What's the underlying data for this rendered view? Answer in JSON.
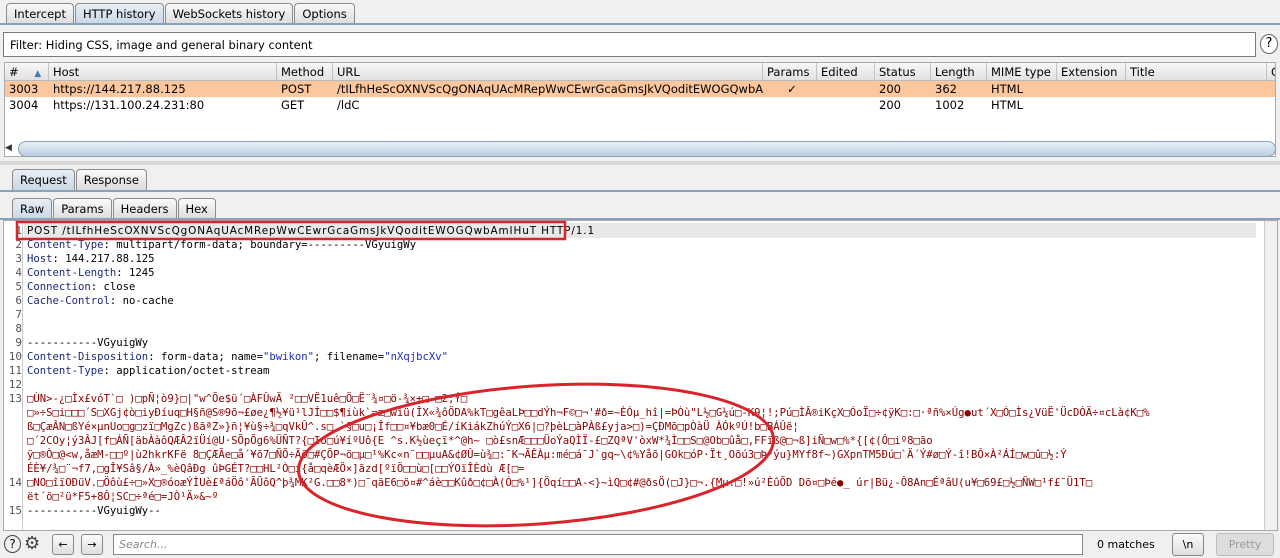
{
  "top_tabs": [
    "Intercept",
    "HTTP history",
    "WebSockets history",
    "Options"
  ],
  "filter": "Filter: Hiding CSS, image and general binary content",
  "help_icon": "?",
  "table": {
    "columns": [
      "#",
      "Host",
      "Method",
      "URL",
      "Params",
      "Edited",
      "Status",
      "Length",
      "MIME type",
      "Extension",
      "Title",
      "C"
    ],
    "sort_icon": "▲",
    "rows": [
      {
        "id": "3003",
        "host": "https://144.217.88.125",
        "method": "POST",
        "url": "/tILfhHeScOXNVScQgONAqUAcMRepWwCEwrGcaGmsJkVQoditEWOGQwbA...",
        "params": "✓",
        "edited": "",
        "status": "200",
        "length": "362",
        "mime": "HTML",
        "ext": "",
        "title": "",
        "selected": true
      },
      {
        "id": "3004",
        "host": "https://131.100.24.231:80",
        "method": "GET",
        "url": "/ldC",
        "params": "",
        "edited": "",
        "status": "200",
        "length": "1002",
        "mime": "HTML",
        "ext": "",
        "title": "",
        "selected": false
      }
    ]
  },
  "msg_tabs": [
    "Request",
    "Response"
  ],
  "view_tabs": [
    "Raw",
    "Params",
    "Headers",
    "Hex"
  ],
  "editor": {
    "line_numbers": [
      "1",
      "2",
      "3",
      "4",
      "5",
      "6",
      "7",
      "8",
      "9",
      "10",
      "11",
      "12",
      "13",
      "14",
      "15"
    ],
    "line1": "POST /tILfhHeScOXNVScQgONAqUAcMRepWwCEwrGcaGmsJkVQoditEWOGQwbAmIHuT HTTP/1.1",
    "headers": [
      {
        "name": "Content-Type",
        "value": ": multipart/form-data; boundary=---------VGyuigWy"
      },
      {
        "name": "Host",
        "value": ": 144.217.88.125"
      },
      {
        "name": "Content-Length",
        "value": ": 1245"
      },
      {
        "name": "Connection",
        "value": ": close"
      },
      {
        "name": "Cache-Control",
        "value": ": no-cache"
      }
    ],
    "boundary": "-----------VGyuigWy",
    "disposition": {
      "name": "Content-Disposition",
      "pre": ": form-data; name=",
      "field": "\"bwikon\"",
      "mid": "; filename=",
      "file": "\"nXqjbcXv\""
    },
    "part_type": {
      "name": "Content-Type",
      "value": ": application/octet-stream"
    },
    "binary_13": [
      "□ÙN>-¿□Ìx£vóT`□ )□pÑ¦ò9}□|\"w^Õe$ü´□ÀFÛwÃ ²□□VË1uê□Ö□Ë¨¾¤□ö-¾×+□ □2;Ý□",
      "□»÷S□i□□□´S□XGj¢ò□iyÐíuq□H§ñ@S®9õ¬£øe¿¶½¥ü¹lJÍ□□$¶iùk`=æ□wiü(ÎX«¾ôÖDA%kT□gêaLÞ□□dÝh¬F©□¬'#ð=~ÈÓµ_hî|=ÞÒù\"L½□G¼ú□-K9¦!;Pú□ÌÂ®iKçX□ÓoÏ□÷¢ÿK□:□·ªñ%×Úg●ut´X□Ó□Ìs¿VüË'ÜcDÓÄ÷¤cLà¢K□%",
      "ß□ÇæÂN□ßYé×µnUo□g□zï□MgZc)ßãªZ»}ñ¦¥ù§÷¾□qVkÛ^.s□ `§□u□¡Îf□□¤¥bæ0□É/íKiákZhúÝ□X6|□?þèL□àPÀß£yja>□)=ÇÐMõ□pÒàÜ ÀÓkºÚ!b□BÁÛë¦",
      "□´2COy¦ý3ÂJ[f□ÁÑ[äbÀàôQÆÂ2ïÜí@U·SÕpÕg6%ÜÑT?{□Io□ú¥íºUô{E ^s.K½ùeçï*^@h~ □ò£snÆ□□□ÜoÝaQÌÏ-£□ZQªV'òxW*¾Ì□□S□@Ob□ûå□,FFïß@□¬ß]iÑ□w□%*{[¢(Ô□iº8□ão",
      "ÿ□®Ò□@<w,åæM-□□º|ù2hkrKFë 8□ÇÆÃe□å´¥õ7□ÑÕ÷Ãõ□#ÇÕP¬ö□µ□¹%Kc«n¨□□µuA&¢ØÛ=ù¾□:¯K¬ÃÊÀµ:mé□á¯J`gq~\\¢%Yåõ|GOk□óP·Ït¸Oõú3□Þ³ýu}MYf8f~)GXpnTM5Ðú□`Ä´Ý#ø□Ý-î!BÔ×À²ÁÍ□w□û□½:Ý",
      "ÉÈ¥/¾□¨¬f7,□gÎ¥Sâ§/À»_%èQâÐg ûÞGÉT?□□HL²Ò□í{å□qèÆÖ×]ãzd[ºïÖ□□ù□[□□ÝOïÎÈdù Æ[□="
    ],
    "binary_14": [
      "□NO□îïOÐüV.□Öôù£÷□»X□®óoæÝÌUè£ªáÖô'ÃÜôQ^þ¾MK²G.□□8*)□¯qäE6□ö¤#^áè□□Kûð□¢□À(Ó□%¹]{Öqí□□A-<}~ìQ□¢#@ðsÖ(□J}□¬.{Mµ.□!»ú²ÈûÕD Dõ¤□Þé●_ úr|Bü¿-Ô8An□ÉªâU(u¥□69£□½□ÑW□¹f£¯Ü1T□",
      "ët´ö□²ü*F5+8Ô¦SC□÷ªé□=JÒ¹Ä»&~º"
    ],
    "boundary_end": "-----------VGyuigWy--"
  },
  "footer": {
    "search_placeholder": "Search...",
    "matches": "0 matches",
    "newline_btn": "\\n",
    "pretty_btn": "Pretty",
    "help": "?",
    "settings_icon": "⚙",
    "prev_icon": "←",
    "next_icon": "→"
  },
  "colors": {
    "selected_row": "#fcc79c",
    "annotation": "#d8242b",
    "header_name": "#1c2a7a",
    "binary": "#8b0000"
  }
}
